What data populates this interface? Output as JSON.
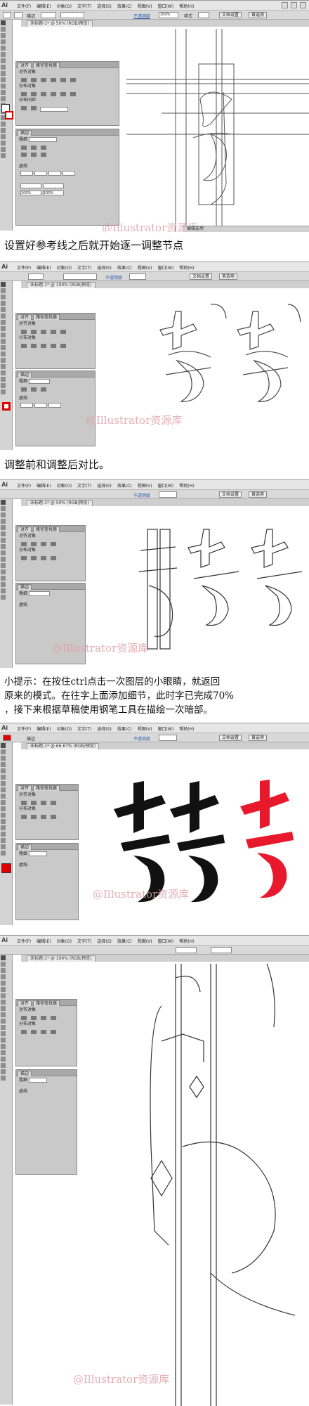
{
  "app": {
    "logo": "Ai",
    "menus": [
      "文件(F)",
      "编辑(E)",
      "对象(O)",
      "文字(T)",
      "选择(S)",
      "效果(C)",
      "视图(V)",
      "窗口(W)",
      "帮助(H)"
    ]
  },
  "control_bar": {
    "fill_label": "描边",
    "opacity_label": "不透明度",
    "opacity_value": "100%",
    "style_label": "样式",
    "doc_setup": "文档设置",
    "prefs": "首选项"
  },
  "panels": {
    "align_tab": "对齐",
    "pathfinder_tab": "路径查找器",
    "align_objects": "对齐对象",
    "distribute_objects": "分布对象",
    "distribute_spacing": "分布间距",
    "align_to": "对齐",
    "stroke_tab": "描边",
    "weight_label": "粗细",
    "dashed_label": "虚线",
    "percent": "100%"
  },
  "shots": [
    {
      "tab": "未标题-1* @ 50% (RGB/预览)",
      "hint": "编辑选项"
    },
    {
      "tab": "未标题-1* @ 100% (RGB/预览)",
      "hint": ""
    },
    {
      "tab": "未标题-1* @ 50% (RGB/预览)",
      "hint": ""
    },
    {
      "tab": "未标题-1* @ 66.67% (RGB/预览)",
      "hint": ""
    },
    {
      "tab": "未标题-1* @ 100% (RGB/预览)",
      "hint": ""
    }
  ],
  "captions": {
    "c1": "设置好参考线之后就开始逐一调整节点",
    "c2": "调整前和调整后对比。",
    "c3_line1": "小提示：在按住ctrl点击一次图层的小眼睛，就返回",
    "c3_line2": "原来的模式。在往字上面添加细节，此时字已完成70%",
    "c3_line3": "，接下来根据草稿使用钢笔工具在描绘一次暗部。"
  },
  "watermark": "@Illustrator资源库",
  "colors": {
    "accent_red": "#e8192c",
    "ink": "#111111",
    "swatch_red": "#e00000"
  }
}
